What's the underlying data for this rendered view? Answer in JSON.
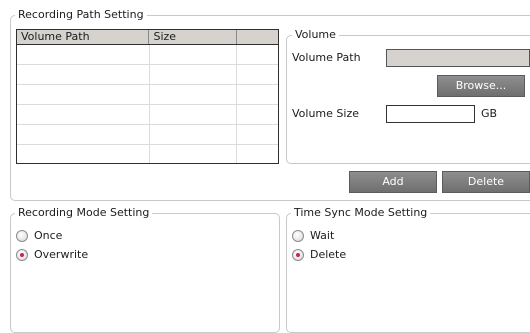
{
  "recording_path": {
    "title": "Recording Path Setting",
    "table": {
      "columns": [
        "Volume Path",
        "Size",
        ""
      ],
      "rows": [
        [
          "",
          "",
          ""
        ],
        [
          "",
          "",
          ""
        ],
        [
          "",
          "",
          ""
        ],
        [
          "",
          "",
          ""
        ],
        [
          "",
          "",
          ""
        ],
        [
          "",
          "",
          ""
        ],
        [
          "",
          "",
          ""
        ]
      ]
    },
    "add_label": "Add",
    "delete_label": "Delete",
    "volume": {
      "title": "Volume",
      "path_label": "Volume Path",
      "path_value": "",
      "browse_label": "Browse...",
      "size_label": "Volume Size",
      "size_value": "",
      "size_unit": "GB"
    }
  },
  "recording_mode": {
    "title": "Recording Mode Setting",
    "options": [
      {
        "label": "Once",
        "checked": false
      },
      {
        "label": "Overwrite",
        "checked": true
      }
    ]
  },
  "time_sync": {
    "title": "Time Sync Mode Setting",
    "options": [
      {
        "label": "Wait",
        "checked": false
      },
      {
        "label": "Delete",
        "checked": true
      }
    ]
  },
  "colors": {
    "radio_dot": "#d0215a",
    "button": "#7d7d7d",
    "header": "#d6d3ce"
  }
}
